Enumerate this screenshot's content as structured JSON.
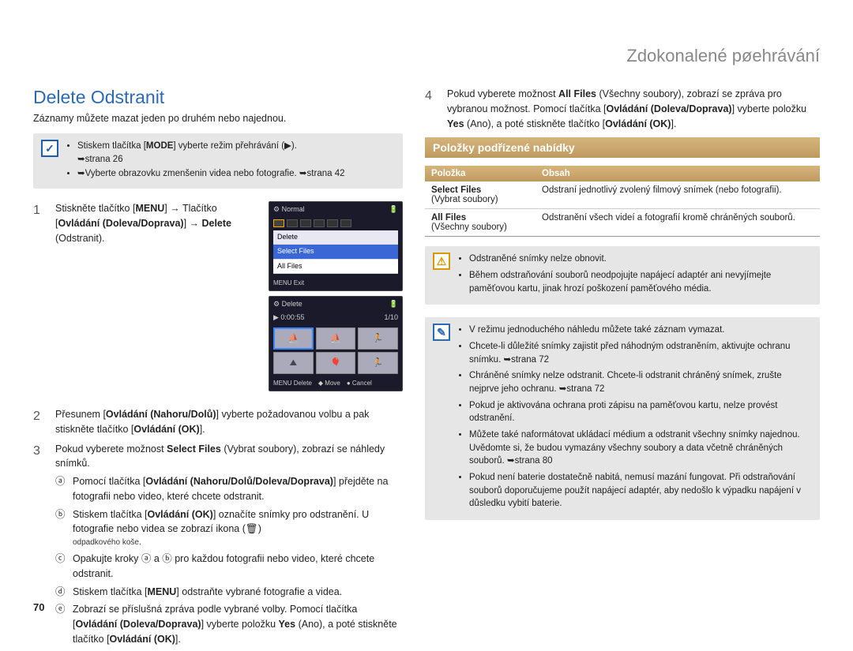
{
  "breadcrumb": "Zdokonalené pøehrávání",
  "section_title": "Delete Odstranit",
  "intro": "Záznamy můžete mazat jeden po druhém nebo najednou.",
  "top_note": {
    "line1_pre": "Stiskem tlačítka [",
    "line1_bold": "MODE",
    "line1_post": "] vyberte režim přehrávání (▶).",
    "line1_ref": "➥strana 26",
    "line2": "➥Vyberte obrazovku zmenšenin videa nebo fotografie. ➥strana 42"
  },
  "lcd1": {
    "title": "Normal",
    "menu_head": "Delete",
    "opt1": "Select Files",
    "opt2": "All Files",
    "foot": "MENU Exit"
  },
  "lcd2": {
    "title": "Delete",
    "time": "0:00:55",
    "count": "1/10",
    "foot1": "MENU Delete",
    "foot2": "Move",
    "foot3": "Cancel"
  },
  "steps": {
    "s1": {
      "num": "1",
      "text_pre": "Stiskněte tlačítko [",
      "text_b1": "MENU",
      "text_mid": "] → Tlačítko [",
      "text_b2": "Ovládání (Doleva/Doprava)",
      "text_mid2": "] → ",
      "text_b3": "Delete",
      "text_post": " (Odstranit)."
    },
    "s2": {
      "num": "2",
      "pre": "Přesunem [",
      "b1": "Ovládání (Nahoru/Dolů)",
      "mid": "] vyberte požadovanou volbu a pak stiskněte tlačítko [",
      "b2": "Ovládání (OK)",
      "post": "]."
    },
    "s3": {
      "num": "3",
      "pre": "Pokud vyberete možnost ",
      "b1": "Select Files",
      "post": " (Vybrat soubory), zobrazí se náhledy snímků.",
      "a_letter": "ⓐ",
      "a_pre": "Pomocí tlačítka [",
      "a_b": "Ovládání (Nahoru/Dolů/Doleva/Doprava)",
      "a_post": " přejděte na fotografii nebo video, které chcete odstranit.",
      "b_letter": "ⓑ",
      "b_pre": "Stiskem tlačítka [",
      "b_b": "Ovládání (OK)",
      "b_post": "] označíte snímky pro odstranění. U fotografie nebo videa se zobrazí ikona (🗑)",
      "b_foot": "odpadkového koše.",
      "c_letter": "ⓒ",
      "c_text": "Opakujte kroky ⓐ a ⓑ pro každou fotografii nebo video, které chcete odstranit.",
      "d_letter": "ⓓ",
      "d_pre": "Stiskem tlačítka [",
      "d_b": "MENU",
      "d_post": "] odstraňte vybrané fotografie a videa.",
      "e_letter": "ⓔ",
      "e_pre": "Zobrazí se příslušná zpráva podle vybrané volby. Pomocí tlačítka [",
      "e_b1": "Ovládání (Doleva/Doprava)",
      "e_mid": "] vyberte položku ",
      "e_b2": "Yes",
      "e_mid2": " (Ano), a poté stiskněte tlačítko [",
      "e_b3": "Ovládání (OK)",
      "e_post": "]."
    },
    "s4": {
      "num": "4",
      "pre": "Pokud vyberete možnost ",
      "b1": "All Files",
      "mid1": " (Všechny soubory), zobrazí se zpráva pro vybranou možnost. Pomocí tlačítka [",
      "b2": "Ovládání (Doleva/Doprava)",
      "mid2": "] vyberte položku ",
      "b3": "Yes",
      "mid3": " (Ano), a poté stiskněte tlačítko [",
      "b4": "Ovládání (OK)",
      "post": "]."
    }
  },
  "heading_bar": "Položky podřízené nabídky",
  "table": {
    "h1": "Položka",
    "h2": "Obsah",
    "r1c1a": "Select Files",
    "r1c1b": "(Vybrat soubory)",
    "r1c2": "Odstraní jednotlivý zvolený filmový snímek (nebo fotografii).",
    "r2c1a": "All Files",
    "r2c1b": "(Všechny soubory)",
    "r2c2": "Odstranění všech videí a fotografií kromě chráněných souborů."
  },
  "warn_box": {
    "b1": "Odstraněné snímky nelze obnovit.",
    "b2": "Během odstraňování souborů neodpojujte napájecí adaptér ani nevyjímejte paměťovou kartu, jinak hrozí poškození paměťového média."
  },
  "info_box": {
    "b1": "V režimu jednoduchého náhledu můžete také záznam vymazat.",
    "b2": "Chcete-li důležité snímky zajistit před náhodným odstraněním, aktivujte ochranu snímku. ➥strana 72",
    "b3": "Chráněné snímky nelze odstranit. Chcete-li odstranit chráněný snímek, zrušte nejprve jeho ochranu. ➥strana 72",
    "b4": "Pokud je aktivována ochrana proti zápisu na paměťovou kartu, nelze provést odstranění.",
    "b5": "Můžete také naformátovat ukládací médium a odstranit všechny snímky najednou. Uvědomte si, že budou vymazány všechny soubory a data včetně chráněných souborů. ➥strana 80",
    "b6": "Pokud není baterie dostatečně nabitá, nemusí mazání fungovat. Při odstraňování souborů doporučujeme použít napájecí adaptér, aby nedošlo k výpadku napájení v důsledku vybití baterie."
  },
  "page_num": "70"
}
